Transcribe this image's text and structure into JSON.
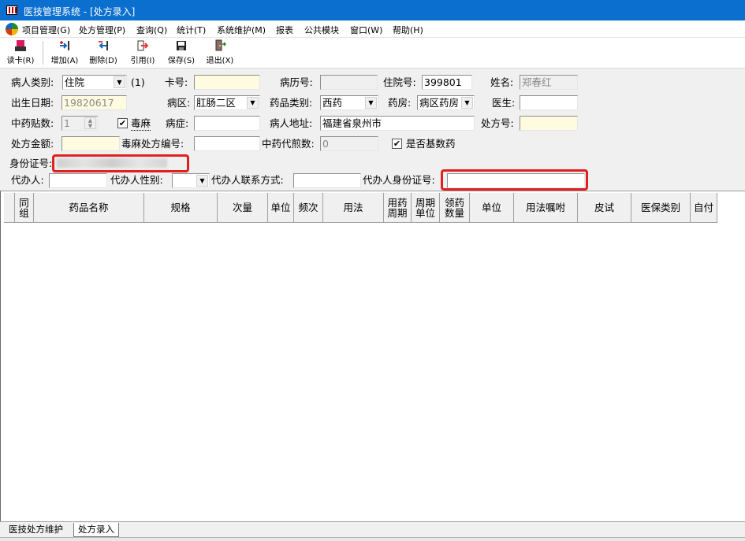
{
  "window": {
    "title": "医技管理系统 - [处方录入]"
  },
  "menu": [
    "项目管理(G)",
    "处方管理(P)",
    "查询(Q)",
    "统计(T)",
    "系统维护(M)",
    "报表",
    "公共模块",
    "窗口(W)",
    "帮助(H)"
  ],
  "toolbar": {
    "read_card": "读卡(R)",
    "add": "增加(A)",
    "delete": "删除(D)",
    "cite": "引用(I)",
    "save": "保存(S)",
    "exit": "退出(X)"
  },
  "form": {
    "patient_type_label": "病人类别:",
    "patient_type": "住院",
    "patient_type_hint": "(1)",
    "card_no_label": "卡号:",
    "card_no": "",
    "record_no_label": "病历号:",
    "record_no": "",
    "admission_no_label": "住院号:",
    "admission_no": "399801",
    "name_label": "姓名:",
    "name": "郑春红",
    "birth_label": "出生日期:",
    "birth": "19820617",
    "ward_label": "病区:",
    "ward": "肛肠二区",
    "drug_type_label": "药品类别:",
    "drug_type": "西药",
    "pharmacy_label": "药房:",
    "pharmacy": "病区药房",
    "doctor_label": "医生:",
    "doctor": "",
    "herb_doses_label": "中药贴数:",
    "herb_doses": "1",
    "toxic_check": "✔",
    "toxic_label": "毒麻",
    "disease_label": "病症:",
    "disease": "",
    "address_label": "病人地址:",
    "address": "福建省泉州市",
    "rx_no_label": "处方号:",
    "rx_no": "",
    "rx_amount_label": "处方金额:",
    "rx_amount": "",
    "toxic_rx_label": "毒麻处方编号:",
    "toxic_rx": "",
    "herb_decoct_label": "中药代煎数:",
    "herb_decoct": "0",
    "essential_check": "✔",
    "essential_label": "是否基数药",
    "id_label": "身份证号:",
    "agent_label": "代办人:",
    "agent": "",
    "agent_sex_label": "代办人性别:",
    "agent_sex": "",
    "agent_phone_label": "代办人联系方式:",
    "agent_phone": "",
    "agent_id_label": "代办人身份证号:",
    "agent_id": ""
  },
  "grid": {
    "columns": [
      {
        "l1": "同",
        "l2": "组"
      },
      {
        "l1": "药品名称",
        "l2": ""
      },
      {
        "l1": "规格",
        "l2": ""
      },
      {
        "l1": "次量",
        "l2": ""
      },
      {
        "l1": "单位",
        "l2": ""
      },
      {
        "l1": "频次",
        "l2": ""
      },
      {
        "l1": "用法",
        "l2": ""
      },
      {
        "l1": "用药",
        "l2": "周期"
      },
      {
        "l1": "周期",
        "l2": "单位"
      },
      {
        "l1": "领药",
        "l2": "数量"
      },
      {
        "l1": "单位",
        "l2": ""
      },
      {
        "l1": "用法嘱咐",
        "l2": ""
      },
      {
        "l1": "皮试",
        "l2": ""
      },
      {
        "l1": "医保类别",
        "l2": ""
      },
      {
        "l1": "自付",
        "l2": ""
      }
    ]
  },
  "tabs": [
    "医技处方维护",
    "处方录入"
  ],
  "colors": {
    "titlebar": "#0b6fd0",
    "highlight": "#e02020",
    "field_yellow": "#fffbe0"
  }
}
